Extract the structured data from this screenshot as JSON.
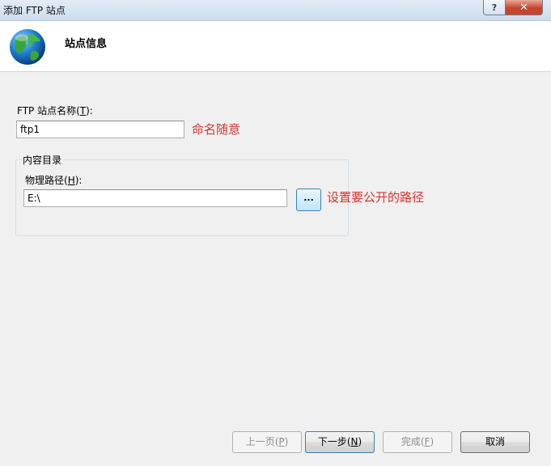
{
  "window": {
    "title": "添加 FTP 站点",
    "help_label": "?",
    "close_label": "✕"
  },
  "header": {
    "title": "站点信息",
    "icon": "globe-icon"
  },
  "site_name": {
    "label_pre": "FTP 站点名称(",
    "label_key": "T",
    "label_post": "):",
    "value": "ftp1",
    "annotation": "命名随意"
  },
  "content_dir": {
    "group_title": "内容目录",
    "path_label_pre": "物理路径(",
    "path_label_key": "H",
    "path_label_post": "):",
    "path_value": "E:\\",
    "browse_label": "...",
    "annotation": "设置要公开的路径"
  },
  "buttons": {
    "prev_pre": "上一页(",
    "prev_key": "P",
    "prev_post": ")",
    "next_pre": "下一步(",
    "next_key": "N",
    "next_post": ")",
    "finish_pre": "完成(",
    "finish_key": "F",
    "finish_post": ")",
    "cancel": "取消"
  },
  "colors": {
    "annotation": "#d9322e",
    "accent_border": "#3c7fb1"
  }
}
